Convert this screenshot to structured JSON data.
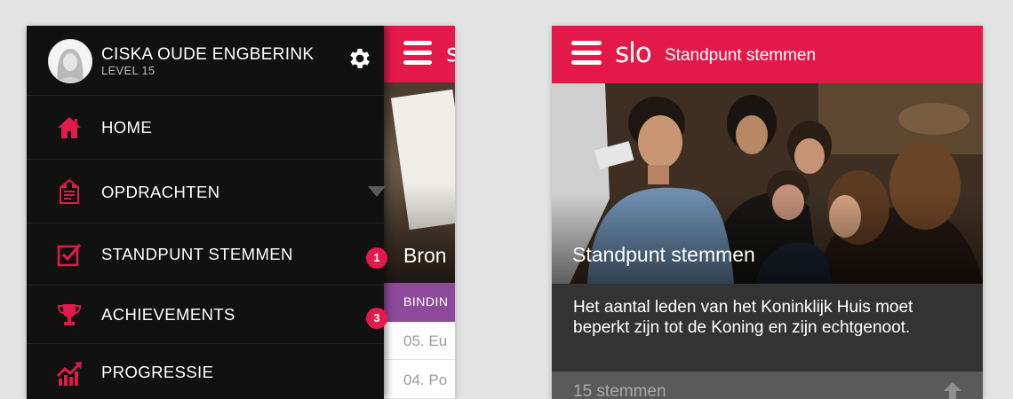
{
  "drawer": {
    "profile": {
      "name": "CISKA OUDE ENGBERINK",
      "level": "LEVEL 15"
    },
    "menu": [
      {
        "label": "HOME",
        "icon": "home-icon"
      },
      {
        "label": "OPDRACHTEN",
        "icon": "document-icon",
        "expandable": true
      },
      {
        "label": "STANDPUNT STEMMEN",
        "icon": "checkbox-icon",
        "badge": "1"
      },
      {
        "label": "ACHIEVEMENTS",
        "icon": "trophy-icon",
        "badge": "3"
      },
      {
        "label": "PROGRESSIE",
        "icon": "progress-chart-icon"
      }
    ]
  },
  "behind_screen": {
    "hero_title": "Bron",
    "band_label": "BINDIN",
    "rows": [
      "05. Eu",
      "04. Po"
    ]
  },
  "main_screen": {
    "logo": "slo",
    "title": "Standpunt stemmen",
    "hero_title": "Standpunt stemmen",
    "statement": "Het aantal leden van het Koninklijk Huis moet beperkt zijn tot de Koning en zijn echtgenoot.",
    "votes": "15 stemmen"
  },
  "colors": {
    "accent": "#e3194a",
    "drawer_bg": "#111112",
    "statement_bg": "#333333",
    "band_purple": "#8e4a9a"
  }
}
